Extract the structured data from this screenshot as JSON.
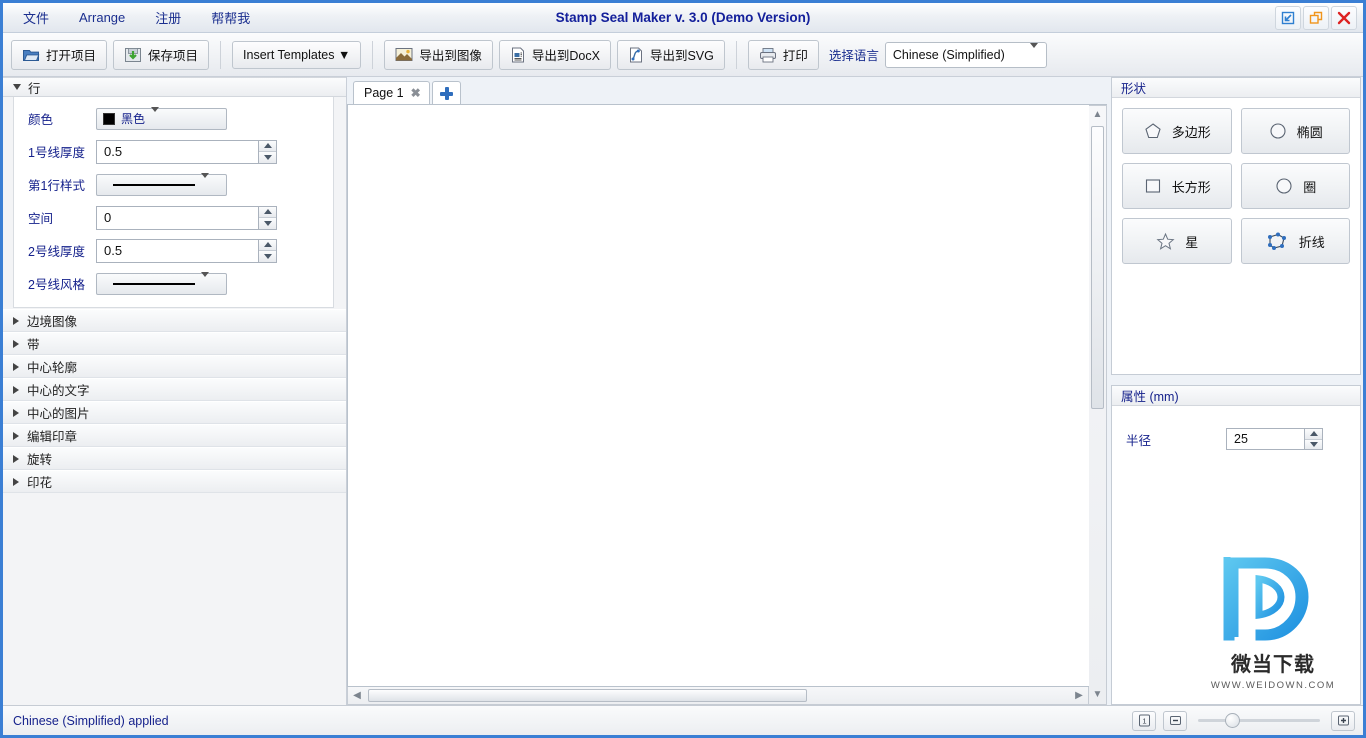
{
  "window": {
    "title": "Stamp Seal Maker v. 3.0 (Demo Version)",
    "menu": [
      "文件",
      "Arrange",
      "注册",
      "帮帮我"
    ],
    "controls": {
      "minimize": "minimize",
      "restore": "restore",
      "close": "close"
    }
  },
  "toolbar": {
    "open_project": "打开项目",
    "save_project": "保存项目",
    "insert_templates": "Insert Templates ▼",
    "export_image": "导出到图像",
    "export_docx": "导出到DocX",
    "export_svg": "导出到SVG",
    "print": "打印",
    "language_label": "选择语言",
    "language_value": "Chinese (Simplified)"
  },
  "left_panel": {
    "expanded_section": {
      "title": "行",
      "fields": [
        {
          "label": "颜色",
          "type": "color",
          "value": "黑色",
          "swatch": "#000000"
        },
        {
          "label": "1号线厚度",
          "type": "spinner",
          "value": "0.5"
        },
        {
          "label": "第1行样式",
          "type": "linestyle",
          "value": "solid"
        },
        {
          "label": "空间",
          "type": "spinner",
          "value": "0"
        },
        {
          "label": "2号线厚度",
          "type": "spinner",
          "value": "0.5"
        },
        {
          "label": "2号线风格",
          "type": "linestyle",
          "value": "solid"
        }
      ]
    },
    "collapsed_sections": [
      "边境图像",
      "带",
      "中心轮廓",
      "中心的文字",
      "中心的图片",
      "编辑印章",
      "旋转",
      "印花"
    ]
  },
  "center": {
    "tabs": [
      {
        "label": "Page 1",
        "close": "✖"
      }
    ],
    "add_tab": "+"
  },
  "right_panel": {
    "shapes": {
      "title": "形状",
      "buttons": [
        {
          "label": "多边形",
          "icon": "pentagon-icon"
        },
        {
          "label": "椭圆",
          "icon": "ellipse-icon"
        },
        {
          "label": "长方形",
          "icon": "rectangle-icon"
        },
        {
          "label": "圈",
          "icon": "circle-icon"
        },
        {
          "label": "星",
          "icon": "star-icon"
        },
        {
          "label": "折线",
          "icon": "polyline-icon"
        }
      ]
    },
    "properties": {
      "title": "属性 (mm)",
      "radius_label": "半径",
      "radius_value": "25"
    }
  },
  "watermark": {
    "name": "微当下载",
    "url": "WWW.WEIDOWN.COM"
  },
  "statusbar": {
    "message": "Chinese (Simplified) applied",
    "zoom_actual": "1:1",
    "zoom_out": "−",
    "zoom_in": "+"
  },
  "colors": {
    "accent": "#3b7fd4",
    "label_blue": "#16228c",
    "title_blue": "#14209b"
  }
}
